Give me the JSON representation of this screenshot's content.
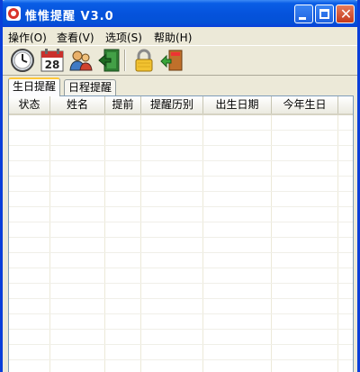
{
  "window": {
    "title": "惟惟提醒 V3.0"
  },
  "menu": {
    "items": [
      {
        "label": "操作(O)"
      },
      {
        "label": "查看(V)"
      },
      {
        "label": "选项(S)"
      },
      {
        "label": "帮助(H)"
      }
    ]
  },
  "toolbar": {
    "icons": [
      "clock-icon",
      "calendar-icon",
      "contacts-icon",
      "exit-door-icon",
      "lock-icon",
      "logout-icon"
    ],
    "calendar_day": "28"
  },
  "tabs": [
    {
      "label": "生日提醒",
      "active": true
    },
    {
      "label": "日程提醒",
      "active": false
    }
  ],
  "table": {
    "columns": [
      {
        "label": "状态"
      },
      {
        "label": "姓名"
      },
      {
        "label": "提前"
      },
      {
        "label": "提醒历别"
      },
      {
        "label": "出生日期"
      },
      {
        "label": "今年生日"
      }
    ],
    "rows": []
  },
  "colors": {
    "titlebar": "#0553dc",
    "frame": "#0a3ed9",
    "close_button": "#c53a1c",
    "face": "#ece9d8",
    "active_tab_accent": "#ffc83c"
  }
}
